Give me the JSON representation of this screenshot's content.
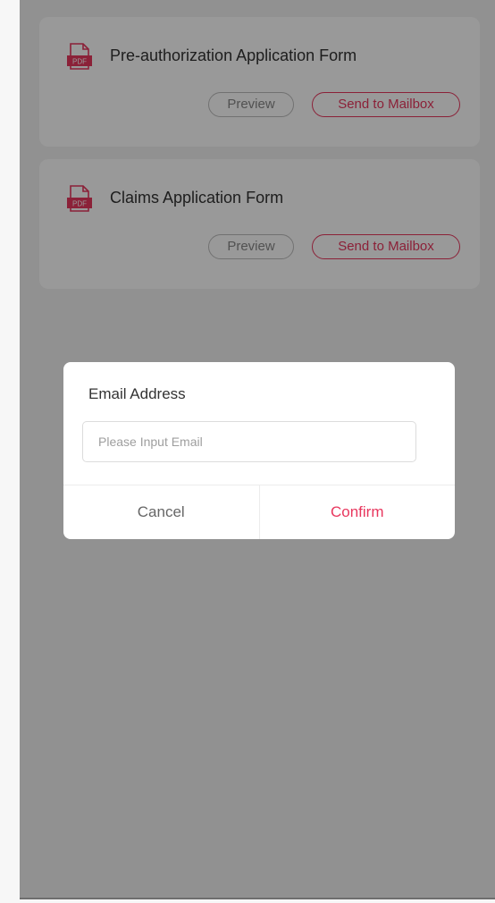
{
  "documents": [
    {
      "icon": "pdf-icon",
      "icon_text": "PDF",
      "title": "Pre-authorization Application Form",
      "preview_label": "Preview",
      "send_label": "Send to Mailbox"
    },
    {
      "icon": "pdf-icon",
      "icon_text": "PDF",
      "title": "Claims Application Form",
      "preview_label": "Preview",
      "send_label": "Send to Mailbox"
    }
  ],
  "dialog": {
    "title": "Email Address",
    "input_value": "",
    "input_placeholder": "Please Input Email",
    "cancel_label": "Cancel",
    "confirm_label": "Confirm"
  },
  "colors": {
    "accent": "#e8375e",
    "overlay": "rgba(0,0,0,0.4)",
    "card_background": "#ffffff",
    "page_background": "#f2f2f2"
  }
}
